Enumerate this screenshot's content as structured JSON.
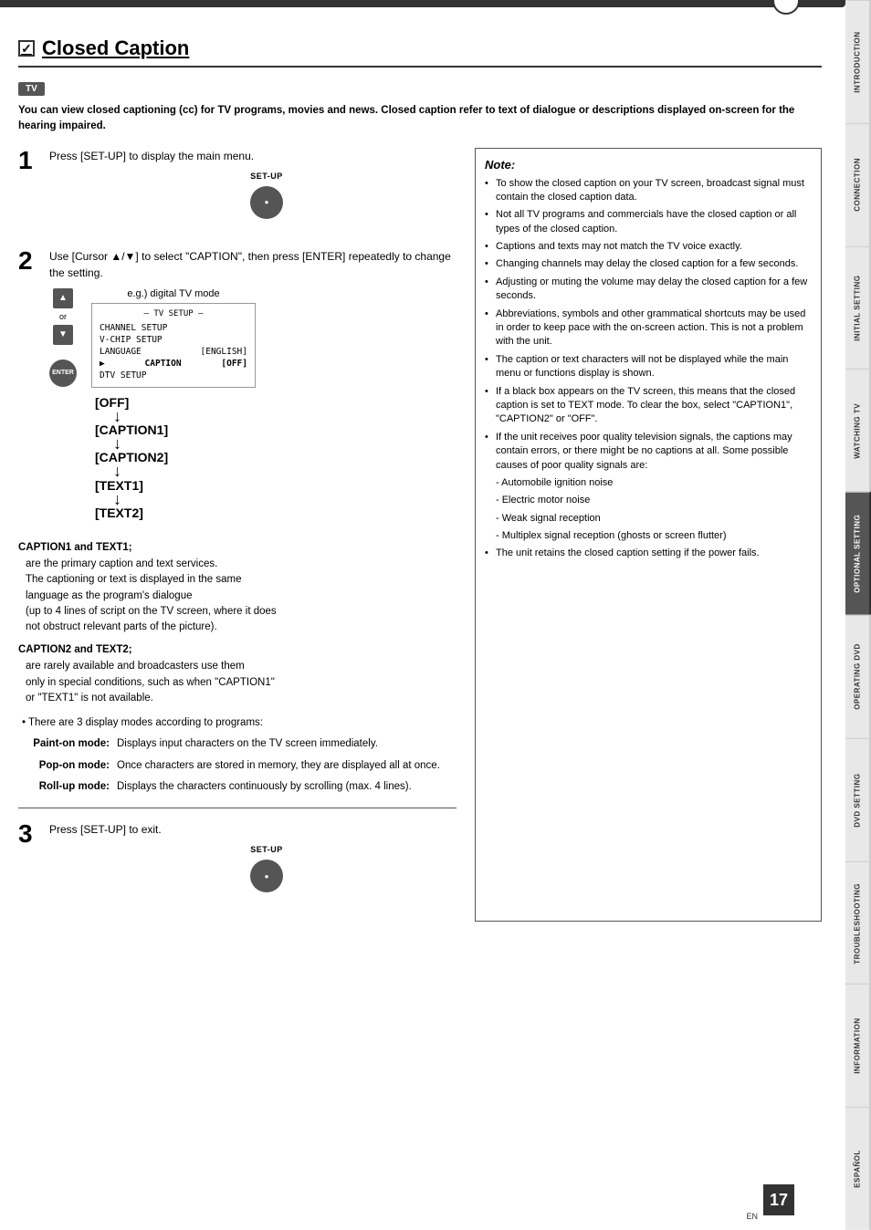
{
  "page": {
    "title": "Closed Caption",
    "checkbox": "✓",
    "tv_badge": "TV",
    "page_number": "17",
    "page_en": "EN"
  },
  "intro": {
    "text": "You can view closed captioning (cc) for TV programs, movies and news. Closed caption refer to text of dialogue or descriptions displayed on-screen for the hearing impaired."
  },
  "steps": [
    {
      "number": "1",
      "text": "Press [SET-UP] to display the main menu.",
      "button_label": "SET-UP"
    },
    {
      "number": "2",
      "text": "Use [Cursor ▲/▼] to select \"CAPTION\", then press [ENTER] repeatedly to change the setting.",
      "eg_label": "e.g.) digital TV mode"
    },
    {
      "number": "3",
      "text": "Press [SET-UP] to exit.",
      "button_label": "SET-UP"
    }
  ],
  "tv_menu": {
    "title": "— TV SETUP —",
    "items": [
      {
        "label": "CHANNEL SETUP",
        "value": "",
        "arrow": false
      },
      {
        "label": "V-CHIP SETUP",
        "value": "",
        "arrow": false
      },
      {
        "label": "LANGUAGE",
        "value": "[ENGLISH]",
        "arrow": false
      },
      {
        "label": "CAPTION",
        "value": "[OFF]",
        "arrow": true
      },
      {
        "label": "DTV SETUP",
        "value": "",
        "arrow": false
      }
    ]
  },
  "caption_sequence": [
    {
      "label": "[OFF]",
      "has_arrow": true
    },
    {
      "label": "[CAPTION1]",
      "has_arrow": true
    },
    {
      "label": "[CAPTION2]",
      "has_arrow": true
    },
    {
      "label": "[TEXT1]",
      "has_arrow": true
    },
    {
      "label": "[TEXT2]",
      "has_arrow": false
    }
  ],
  "descriptions": {
    "caption1_title": "CAPTION1 and TEXT1;",
    "caption1_text": "are the primary caption and text services.\nThe captioning or text is displayed in the same\nlanguage as the program's dialogue\n(up to 4 lines of script on the TV screen, where it does\nnot obstruct relevant parts of the picture).",
    "caption2_title": "CAPTION2 and TEXT2;",
    "caption2_text": "are rarely available and broadcasters use them\nonly in special conditions, such as when \"CAPTION1\"\nor \"TEXT1\" is not available.",
    "bullet": "• There are 3 display modes according to programs:",
    "modes": [
      {
        "label": "Paint-on mode:",
        "desc": "Displays input characters on the TV screen immediately."
      },
      {
        "label": "Pop-on mode:",
        "desc": "Once characters are stored in memory, they are displayed all at once."
      },
      {
        "label": "Roll-up mode:",
        "desc": "Displays the characters continuously by scrolling (max. 4 lines)."
      }
    ]
  },
  "note": {
    "title": "Note:",
    "items": [
      "To show the closed caption on your TV screen, broadcast signal must contain the closed caption data.",
      "Not all TV programs and commercials have the closed caption or all types of the closed caption.",
      "Captions and texts may not match the TV voice exactly.",
      "Changing channels may delay the closed caption for a few seconds.",
      "Adjusting or muting the volume may delay the closed caption for a few seconds.",
      "Abbreviations, symbols and other grammatical shortcuts may be used in order to keep pace with the on-screen action. This is not a problem with the unit.",
      "The caption or text characters will not be displayed while the main menu or functions display is shown.",
      "If a black box appears on the TV screen, this means that the closed caption is set to TEXT mode. To clear the box, select \"CAPTION1\", \"CAPTION2\" or \"OFF\".",
      "If the unit receives poor quality television signals, the captions may contain errors, or there might be no captions at all. Some possible causes of poor quality signals are:",
      "- Automobile ignition noise",
      "- Electric motor noise",
      "- Weak signal reception",
      "- Multiplex signal reception (ghosts or screen flutter)",
      "The unit retains the closed caption setting if the power fails."
    ]
  },
  "side_tabs": [
    {
      "label": "INTRODUCTION",
      "active": false
    },
    {
      "label": "CONNECTION",
      "active": false
    },
    {
      "label": "INITIAL SETTING",
      "active": false
    },
    {
      "label": "WATCHING TV",
      "active": false
    },
    {
      "label": "OPTIONAL SETTING",
      "active": true
    },
    {
      "label": "OPERATING DVD",
      "active": false
    },
    {
      "label": "DVD SETTING",
      "active": false
    },
    {
      "label": "TROUBLESHOOTING",
      "active": false
    },
    {
      "label": "INFORMATION",
      "active": false
    },
    {
      "label": "ESPAÑOL",
      "active": false
    }
  ]
}
